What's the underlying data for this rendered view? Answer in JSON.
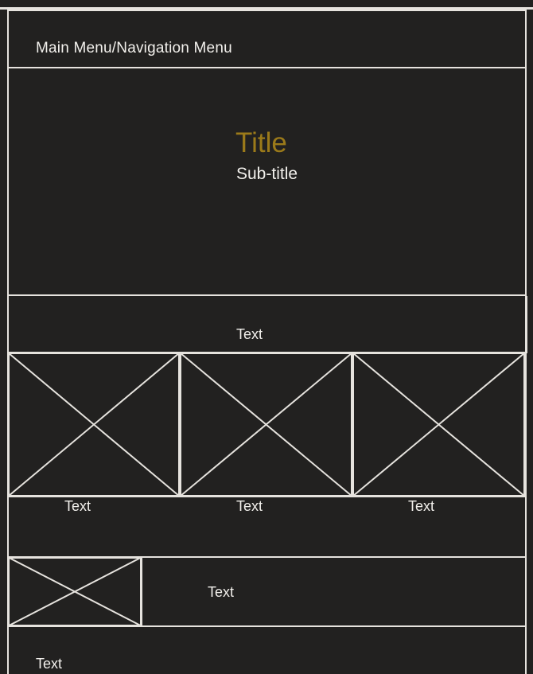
{
  "nav": {
    "label": "Main Menu/Navigation Menu"
  },
  "hero": {
    "title": "Title",
    "subtitle": "Sub-title"
  },
  "band": {
    "text": "Text"
  },
  "gallery": {
    "items": [
      {
        "caption": "Text",
        "icon": "image-placeholder-icon"
      },
      {
        "caption": "Text",
        "icon": "image-placeholder-icon"
      },
      {
        "caption": "Text",
        "icon": "image-placeholder-icon"
      }
    ]
  },
  "media": {
    "text": "Text",
    "icon": "image-placeholder-icon"
  },
  "footer": {
    "text": "Text"
  },
  "colors": {
    "background": "#222120",
    "line": "#e6e3de",
    "title": "#9b7a1a",
    "text": "#f2f0ec"
  }
}
